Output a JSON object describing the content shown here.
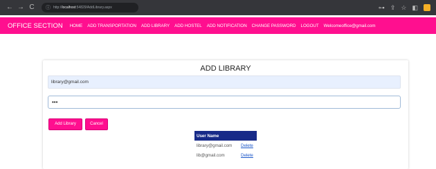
{
  "browser": {
    "back": "←",
    "forward": "→",
    "reload": "C",
    "info": "ⓘ",
    "url_host": "localhost",
    "url_prefix": "http://",
    "url_path": ":54829/AddLibrary.aspx",
    "icons": [
      "key-icon",
      "share-icon",
      "star-icon",
      "sidebar-icon",
      "extension-icon"
    ],
    "key": "⊶",
    "share": "⇪",
    "star": "☆",
    "sidebar": "◧"
  },
  "navbar": {
    "brand": "OFFICE SECTION",
    "links": [
      "HOME",
      "ADD TRANSPORTATION",
      "ADD LIBRARY",
      "ADD HOSTEL",
      "ADD NOTIFICATION",
      "CHANGE PASSWORD",
      "LOGOUT",
      "Welcomeoffice@gmail.com"
    ]
  },
  "form": {
    "title": "ADD LIBRARY",
    "email_value": "library@gmail.com",
    "password_value": "•••",
    "add_button": "Add Library",
    "cancel_button": "Cancel"
  },
  "table": {
    "header": "User Name",
    "rows": [
      {
        "user": "library@gmail.com",
        "action": "Delete"
      },
      {
        "user": "lib@gmail.com",
        "action": "Delete"
      }
    ]
  },
  "colors": {
    "accent": "#ff0f8f",
    "table_header": "#172a88",
    "link": "#1a56c9"
  }
}
